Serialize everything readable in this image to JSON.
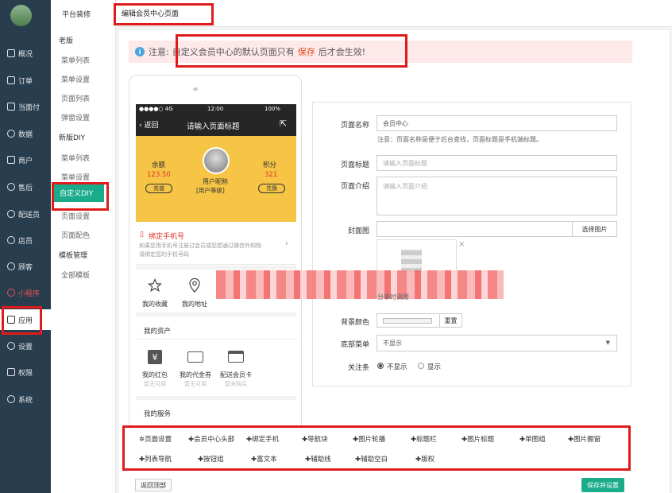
{
  "leftnav": {
    "items": [
      {
        "label": "概况",
        "icon": "chart-icon"
      },
      {
        "label": "订单",
        "icon": "order-icon"
      },
      {
        "label": "当面付",
        "icon": "payment-icon"
      },
      {
        "label": "数据",
        "icon": "data-icon"
      },
      {
        "label": "商户",
        "icon": "shop-icon"
      },
      {
        "label": "售后",
        "icon": "aftersale-icon"
      },
      {
        "label": "配送员",
        "icon": "delivery-icon"
      },
      {
        "label": "店员",
        "icon": "clerk-icon"
      },
      {
        "label": "顾客",
        "icon": "customer-icon"
      },
      {
        "label": "小程序",
        "icon": "miniprogram-icon"
      },
      {
        "label": "应用",
        "icon": "apps-icon"
      },
      {
        "label": "设置",
        "icon": "gear-icon"
      },
      {
        "label": "权限",
        "icon": "lock-icon"
      },
      {
        "label": "系统",
        "icon": "system-icon"
      }
    ]
  },
  "subnav": {
    "title": "平台装修",
    "old_group": "老版",
    "old_items": [
      "菜单列表",
      "菜单设置",
      "页面列表",
      "弹窗设置"
    ],
    "new_group": "新版DIY",
    "new_items": [
      "菜单列表",
      "菜单设置",
      "自定义DIY",
      "页面设置",
      "页面配色"
    ],
    "tpl_group": "模板管理",
    "tpl_items": [
      "全部模板"
    ]
  },
  "header": {
    "page_title": "编辑会员中心页面"
  },
  "notice": {
    "prefix": "注意:",
    "text1": "自定义会员中心的默认页面只有",
    "save": "保存",
    "text2": "后才会生效!"
  },
  "phone": {
    "status_left": "●●●●○ 4G",
    "status_time": "12:00",
    "status_right": "100%",
    "back": "返回",
    "title": "请输入页面标题",
    "balance_label": "余额",
    "balance_value": "123.50",
    "recharge": "充值",
    "points_label": "积分",
    "points_value": "321",
    "redeem": "兑换",
    "nickname": "用户昵称",
    "level": "[用户等级]",
    "bind_title": "绑定手机号",
    "bind_desc1": "如果您用手机号注册过会员或您想通过微信外购物",
    "bind_desc2": "请绑定您的手机号码",
    "fav": "我的收藏",
    "addr": "我的地址",
    "assets_title": "我的资产",
    "redpack": "我的红包",
    "redpack_sub": "暂无可用",
    "voucher": "我的代金券",
    "voucher_sub": "暂无可用",
    "card": "配送会员卡",
    "card_sub": "暂未购买",
    "services_title": "我的服务"
  },
  "form": {
    "name_label": "页面名称",
    "name_value": "会员中心",
    "name_hint": "注意：页面名称是便于后台查找，页面标题是手机端标题。",
    "title_label": "页面标题",
    "title_placeholder": "请输入页面标题",
    "intro_label": "页面介绍",
    "intro_placeholder": "请输入页面介绍",
    "cover_label": "封面图",
    "choose_image": "选择图片",
    "share_hint": "分享时调用",
    "bg_label": "背景颜色",
    "reset": "重置",
    "menu_label": "底部菜单",
    "menu_value": "不显示",
    "follow_label": "关注条",
    "opt_hide": "不显示",
    "opt_show": "显示"
  },
  "toolbar": {
    "row1": [
      "页面设置",
      "会员中心头部",
      "绑定手机",
      "导航块",
      "图片轮播",
      "标题栏",
      "图片标题",
      "单图组",
      "图片橱窗"
    ],
    "row2": [
      "列表导航",
      "按钮组",
      "富文本",
      "辅助线",
      "辅助空白",
      "版权"
    ]
  },
  "footer": {
    "back_top": "返回顶部",
    "save": "保存并设置"
  },
  "colors": {
    "nav_bg": "#283d4e",
    "accent": "#1aab8a",
    "member_bg": "#f6c546",
    "highlight": "#e01b1b"
  }
}
